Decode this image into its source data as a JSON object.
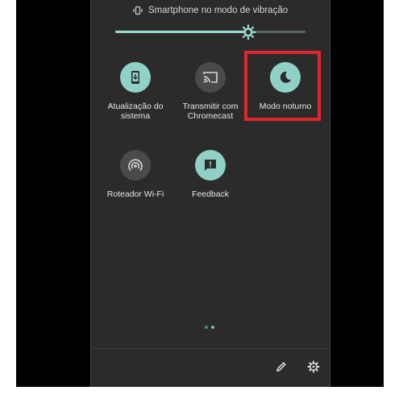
{
  "status": {
    "vibration_text": "Smartphone no modo de vibração",
    "icon": "vibrate-icon"
  },
  "brightness": {
    "level_fraction": 0.7,
    "icon": "brightness-icon"
  },
  "tiles": [
    {
      "label": "Atualização do\nsistema",
      "icon": "system-update-icon",
      "active": true
    },
    {
      "label": "Transmitir com\nChromecast",
      "icon": "cast-icon",
      "active": false
    },
    {
      "label": "Modo noturno",
      "icon": "moon-icon",
      "active": true
    },
    {
      "label": "Roteador Wi-Fi",
      "icon": "hotspot-icon",
      "active": false
    },
    {
      "label": "Feedback",
      "icon": "feedback-icon",
      "active": true
    }
  ],
  "pager": {
    "pages": 2,
    "current": 1
  },
  "footer": {
    "edit_icon": "edit-icon",
    "settings_icon": "settings-icon"
  },
  "colors": {
    "accent": "#8fd1c6",
    "panel": "#2b2b2b",
    "inactive": "#4a4a4a",
    "highlight": "#e0262d"
  }
}
